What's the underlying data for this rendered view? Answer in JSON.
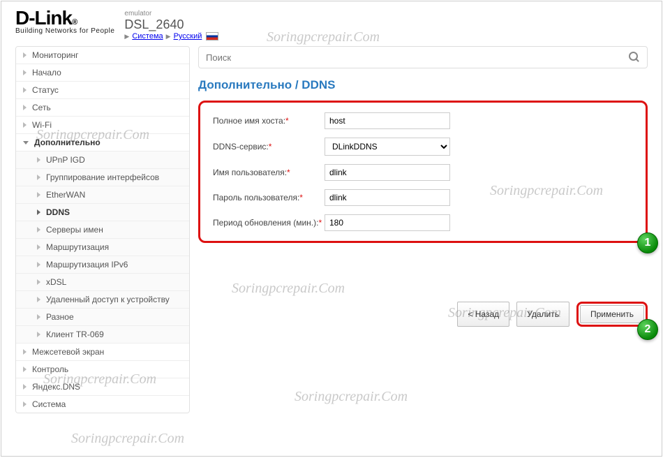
{
  "header": {
    "logo_brand": "D-Link",
    "logo_tagline": "Building Networks for People",
    "emulator_label": "emulator",
    "model": "DSL_2640",
    "breadcrumb_system": "Система",
    "breadcrumb_lang": "Русский"
  },
  "search": {
    "placeholder": "Поиск"
  },
  "page": {
    "title": "Дополнительно /  DDNS"
  },
  "sidebar": {
    "items": [
      {
        "label": "Мониторинг"
      },
      {
        "label": "Начало"
      },
      {
        "label": "Статус"
      },
      {
        "label": "Сеть"
      },
      {
        "label": "Wi-Fi"
      },
      {
        "label": "Дополнительно",
        "expanded": true,
        "children": [
          {
            "label": "UPnP IGD"
          },
          {
            "label": "Группирование интерфейсов"
          },
          {
            "label": "EtherWAN"
          },
          {
            "label": "DDNS",
            "active": true
          },
          {
            "label": "Серверы имен"
          },
          {
            "label": "Маршрутизация"
          },
          {
            "label": "Маршрутизация IPv6"
          },
          {
            "label": "xDSL"
          },
          {
            "label": "Удаленный доступ к устройству"
          },
          {
            "label": "Разное"
          },
          {
            "label": "Клиент TR-069"
          }
        ]
      },
      {
        "label": "Межсетевой экран"
      },
      {
        "label": "Контроль"
      },
      {
        "label": "Яндекс.DNS"
      },
      {
        "label": "Система"
      }
    ]
  },
  "form": {
    "hostname_label": "Полное имя хоста:",
    "hostname_value": "host",
    "service_label": "DDNS-сервис:",
    "service_value": "DLinkDDNS",
    "username_label": "Имя пользователя:",
    "username_value": "dlink",
    "password_label": "Пароль пользователя:",
    "password_value": "dlink",
    "period_label": "Период обновления (мин.):",
    "period_value": "180"
  },
  "buttons": {
    "back": "< Назад",
    "delete": "Удалить",
    "apply": "Применить"
  },
  "callouts": {
    "c1": "1",
    "c2": "2"
  },
  "watermark": "Soringpcrepair.Com"
}
